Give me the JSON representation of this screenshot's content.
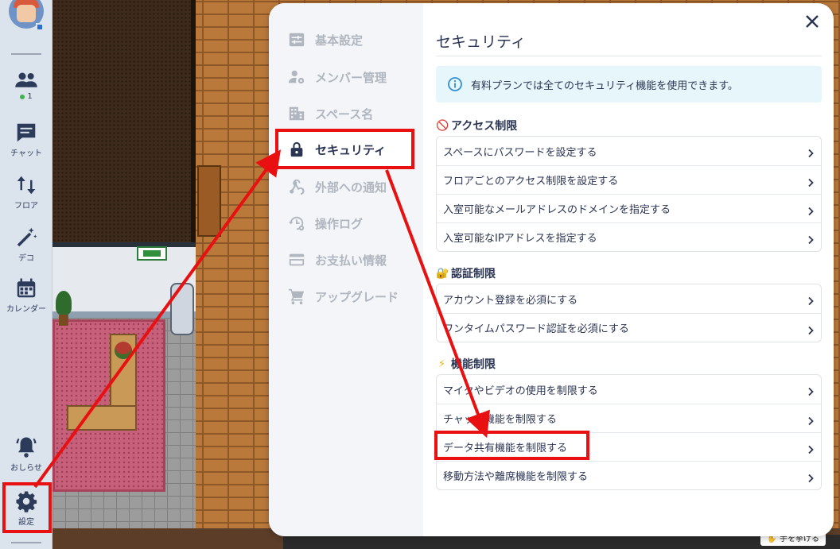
{
  "sidebar": {
    "online_count": "1",
    "items": [
      {
        "label": "",
        "icon": "users-icon"
      },
      {
        "label": "チャット",
        "icon": "chat-icon"
      },
      {
        "label": "フロア",
        "icon": "floor-icon"
      },
      {
        "label": "デコ",
        "icon": "magic-wand-icon"
      },
      {
        "label": "カレンダー",
        "icon": "calendar-icon"
      },
      {
        "label": "おしらせ",
        "icon": "bell-icon"
      },
      {
        "label": "設定",
        "icon": "gear-icon"
      }
    ]
  },
  "modal": {
    "nav": [
      {
        "label": "基本設定",
        "icon": "sliders-icon",
        "active": false
      },
      {
        "label": "メンバー管理",
        "icon": "user-gear-icon",
        "active": false
      },
      {
        "label": "スペース名",
        "icon": "building-icon",
        "active": false
      },
      {
        "label": "セキュリティ",
        "icon": "lock-icon",
        "active": true
      },
      {
        "label": "外部への通知",
        "icon": "webhook-icon",
        "active": false
      },
      {
        "label": "操作ログ",
        "icon": "history-gear-icon",
        "active": false
      },
      {
        "label": "お支払い情報",
        "icon": "credit-card-icon",
        "active": false
      },
      {
        "label": "アップグレード",
        "icon": "cart-icon",
        "active": false
      }
    ],
    "title": "セキュリティ",
    "info": "有料プランでは全てのセキュリティ機能を使用できます。",
    "sections": [
      {
        "heading": "アクセス制限",
        "glyph": "🚫",
        "rows": [
          "スペースにパスワードを設定する",
          "フロアごとのアクセス制限を設定する",
          "入室可能なメールアドレスのドメインを指定する",
          "入室可能なIPアドレスを指定する"
        ]
      },
      {
        "heading": "認証制限",
        "glyph": "🔐",
        "rows": [
          "アカウント登録を必須にする",
          "ワンタイムパスワード認証を必須にする"
        ]
      },
      {
        "heading": "機能制限",
        "glyph": "⚡",
        "rows": [
          "マイクやビデオの使用を制限する",
          "チャット機能を制限する",
          "データ共有機能を制限する",
          "移動方法や離席機能を制限する"
        ]
      }
    ]
  },
  "footer": {
    "raise_hand": "手を挙げる"
  },
  "colors": {
    "accent_red": "#e81010",
    "text_dark": "#2b3553",
    "info_bg": "#e7f6fb",
    "info_icon": "#2f8fd4"
  }
}
